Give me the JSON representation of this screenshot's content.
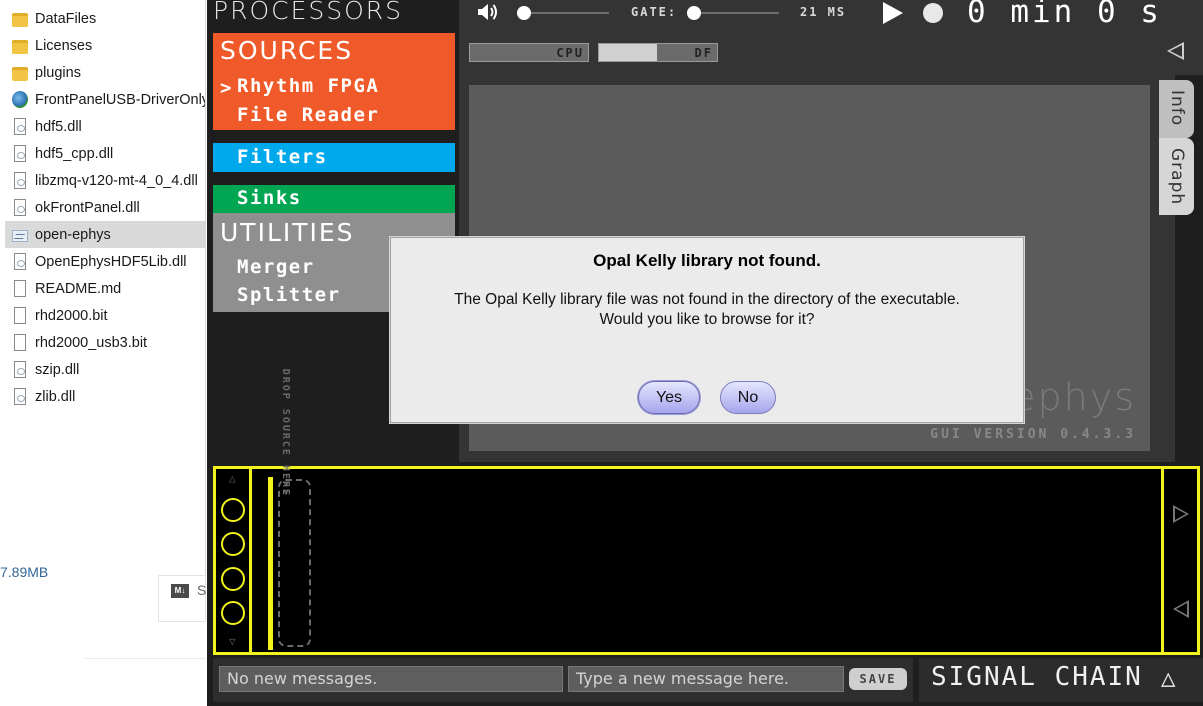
{
  "explorer": {
    "files": [
      {
        "name": "DataFiles",
        "icon": "folder-icon"
      },
      {
        "name": "Licenses",
        "icon": "folder-icon"
      },
      {
        "name": "plugins",
        "icon": "folder-icon"
      },
      {
        "name": "FrontPanelUSB-DriverOnly",
        "icon": "installer-icon"
      },
      {
        "name": "hdf5.dll",
        "icon": "dll-file-icon"
      },
      {
        "name": "hdf5_cpp.dll",
        "icon": "dll-file-icon"
      },
      {
        "name": "libzmq-v120-mt-4_0_4.dll",
        "icon": "dll-file-icon"
      },
      {
        "name": "okFrontPanel.dll",
        "icon": "dll-file-icon"
      },
      {
        "name": "open-ephys",
        "icon": "application-icon"
      },
      {
        "name": "OpenEphysHDF5Lib.dll",
        "icon": "dll-file-icon"
      },
      {
        "name": "README.md",
        "icon": "document-icon"
      },
      {
        "name": "rhd2000.bit",
        "icon": "document-icon"
      },
      {
        "name": "rhd2000_usb3.bit",
        "icon": "document-icon"
      },
      {
        "name": "szip.dll",
        "icon": "dll-file-icon"
      },
      {
        "name": "zlib.dll",
        "icon": "dll-file-icon"
      }
    ],
    "selected_index": 8,
    "status_size": "7.89MB"
  },
  "processors": {
    "title": "PROCESSORS",
    "sources": {
      "header": "SOURCES",
      "items": [
        "Rhythm FPGA",
        "File Reader"
      ],
      "selected_marker": ">"
    },
    "filters": {
      "header": "Filters"
    },
    "sinks": {
      "header": "Sinks"
    },
    "utilities": {
      "header": "UTILITIES",
      "items": [
        "Merger",
        "Splitter"
      ]
    },
    "colors": {
      "sources": "#f05a2a",
      "filters": "#00a9ec",
      "sinks": "#00a651",
      "utilities": "#8f8f8f"
    }
  },
  "controls": {
    "gate_label": "GATE:",
    "latency": "21 MS",
    "clock": "0 min 0 s",
    "cpu_label": "CPU",
    "df_label": "DF",
    "df_fill": 0.49
  },
  "viewport": {
    "logo": "ephys",
    "version": "GUI VERSION 0.4.3.3",
    "tabs": [
      "Info",
      "Graph"
    ]
  },
  "editor": {
    "drop_label": "DROP SOURCE HERE",
    "drop_arrows": ">>",
    "accent": "#f2f21c"
  },
  "messages": {
    "status": "No new messages.",
    "input_placeholder": "Type a new message here.",
    "save_label": "SAVE"
  },
  "signal_chain": {
    "label": "SIGNAL CHAIN"
  },
  "dialog": {
    "title": "Opal Kelly library not found.",
    "message_line1": "The Opal Kelly library file was not found in the directory of the executable.",
    "message_line2": "Would you like to browse for it?",
    "yes_label": "Yes",
    "no_label": "No"
  }
}
